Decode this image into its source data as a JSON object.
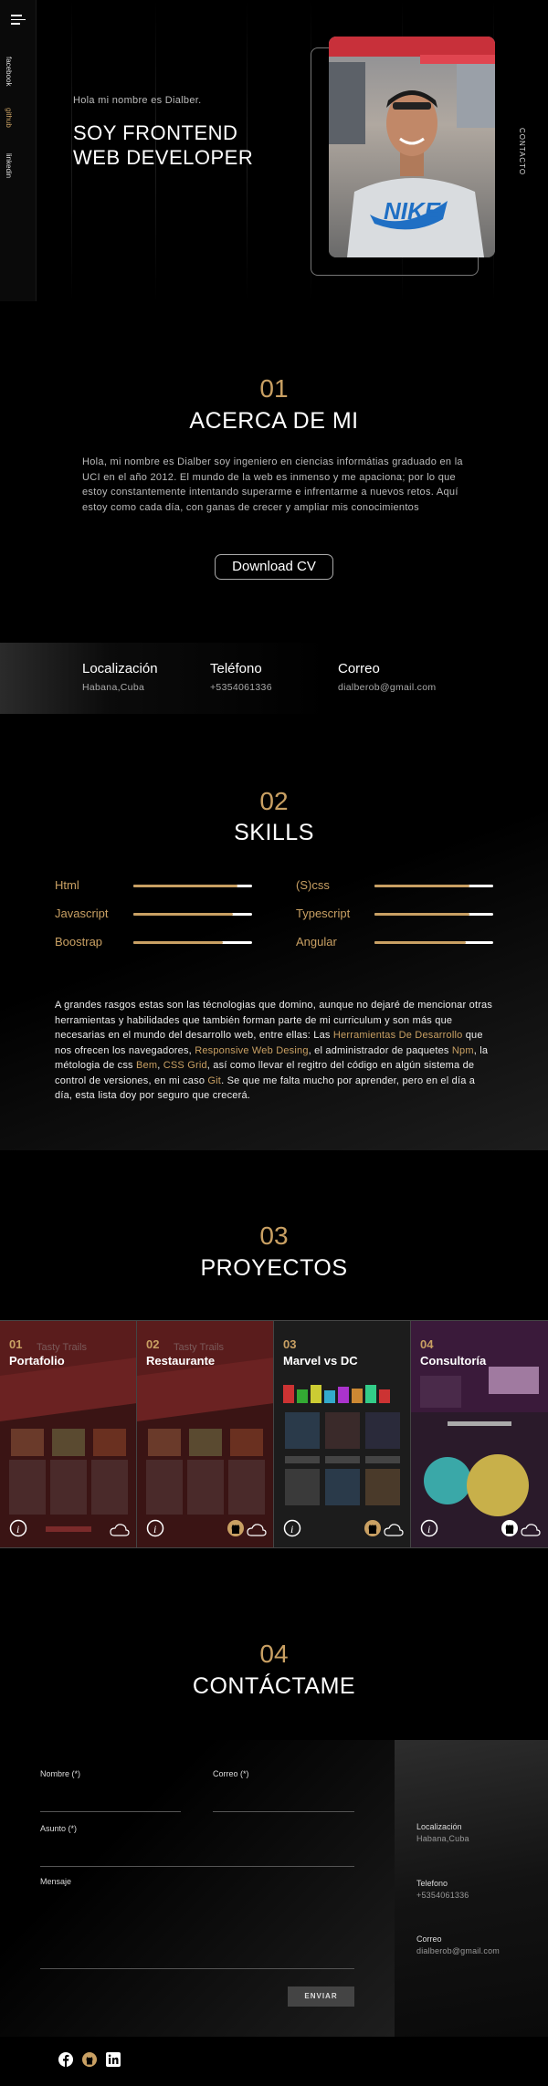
{
  "nav": {
    "social": [
      "facebook",
      "github",
      "linkedin"
    ],
    "contact_label": "CONTACTO"
  },
  "hero": {
    "greeting": "Hola mi nombre es Dialber.",
    "title_line1": "SOY FRONTEND",
    "title_line2": "WEB DEVELOPER"
  },
  "about": {
    "number": "01",
    "title": "ACERCA DE MI",
    "text": "Hola, mi nombre es Dialber soy ingeniero en ciencias informátias graduado en la UCI en el año 2012. El mundo de la web es inmenso y me apaciona; por lo que estoy constantemente intentando superarme e infrentarme a nuevos retos. Aquí estoy como cada día, con ganas de crecer y ampliar mis conocimientos",
    "cv_button": "Download CV"
  },
  "info": [
    {
      "label": "Localización",
      "value": "Habana,Cuba"
    },
    {
      "label": "Teléfono",
      "value": "+5354061336"
    },
    {
      "label": "Correo",
      "value": "dialberob@gmail.com"
    }
  ],
  "skills": {
    "number": "02",
    "title": "SKILLS",
    "items": [
      {
        "name": "Html",
        "level": 0.88
      },
      {
        "name": "(S)css",
        "level": 0.8
      },
      {
        "name": "Javascript",
        "level": 0.84
      },
      {
        "name": "Typescript",
        "level": 0.8
      },
      {
        "name": "Boostrap",
        "level": 0.75
      },
      {
        "name": "Angular",
        "level": 0.77
      }
    ],
    "text_parts": [
      {
        "t": "A grandes rasgos estas son las técnologias que domino, aunque no dejaré de mencionar otras herramientas y habilidades que también forman parte de mi curriculum y son más que necesarias en el mundo del desarrollo web, entre ellas: Las ",
        "hl": false
      },
      {
        "t": "Herramientas De Desarrollo",
        "hl": true
      },
      {
        "t": " que nos ofrecen los navegadores, ",
        "hl": false
      },
      {
        "t": "Responsive Web Desing",
        "hl": true
      },
      {
        "t": ", el administrador de paquetes ",
        "hl": false
      },
      {
        "t": "Npm",
        "hl": true
      },
      {
        "t": ", la métologia de css ",
        "hl": false
      },
      {
        "t": "Bem",
        "hl": true
      },
      {
        "t": ", ",
        "hl": false
      },
      {
        "t": "CSS Grid",
        "hl": true
      },
      {
        "t": ", así como llevar el regitro del código en algún sistema de control de versiones, en mi caso ",
        "hl": false
      },
      {
        "t": "Git",
        "hl": true
      },
      {
        "t": ". Se que me falta mucho por aprender, pero en el día a día, esta lista doy por seguro que crecerá.",
        "hl": false
      }
    ]
  },
  "projects": {
    "number": "03",
    "title": "PROYECTOS",
    "items": [
      {
        "num": "01",
        "name": "Portafolio",
        "github": false
      },
      {
        "num": "02",
        "name": "Restaurante",
        "github": true
      },
      {
        "num": "03",
        "name": "Marvel vs DC",
        "github": true
      },
      {
        "num": "04",
        "name": "Consultoría",
        "github": true
      }
    ]
  },
  "contact": {
    "number": "04",
    "title": "CONTÁCTAME",
    "name_label": "Nombre (*)",
    "email_label": "Correo (*)",
    "subject_label": "Asunto (*)",
    "message_label": "Mensaje",
    "send_button": "ENVIAR",
    "side": [
      {
        "label": "Localización",
        "value": "Habana,Cuba"
      },
      {
        "label": "Telefono",
        "value": "+5354061336"
      },
      {
        "label": "Correo",
        "value": "dialberob@gmail.com"
      }
    ]
  },
  "colors": {
    "accent": "#c9a063",
    "background": "#000000"
  }
}
